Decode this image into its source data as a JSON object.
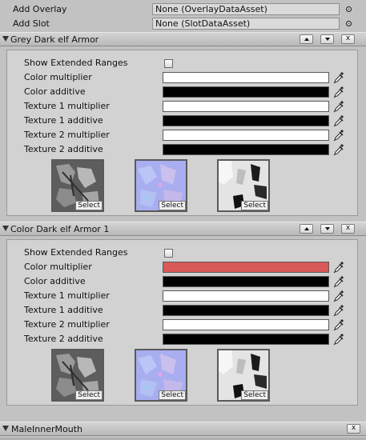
{
  "add_overlay": {
    "label": "Add Overlay",
    "value": "None (OverlayDataAsset)"
  },
  "add_slot": {
    "label": "Add Slot",
    "value": "None (SlotDataAsset)"
  },
  "sections": [
    {
      "title": "Grey Dark elf Armor",
      "show_extended_label": "Show Extended Ranges",
      "rows": [
        {
          "label": "Color multiplier",
          "color": "#ffffff"
        },
        {
          "label": "Color additive",
          "color": "#000000"
        },
        {
          "label": "Texture 1 multiplier",
          "color": "#ffffff"
        },
        {
          "label": "Texture 1 additive",
          "color": "#000000"
        },
        {
          "label": "Texture 2 multiplier",
          "color": "#ffffff"
        },
        {
          "label": "Texture 2 additive",
          "color": "#000000"
        }
      ],
      "textures": [
        {
          "select_label": "Select"
        },
        {
          "select_label": "Select"
        },
        {
          "select_label": "Select"
        }
      ]
    },
    {
      "title": "Color Dark elf Armor 1",
      "show_extended_label": "Show Extended Ranges",
      "rows": [
        {
          "label": "Color multiplier",
          "color": "#d95858"
        },
        {
          "label": "Color additive",
          "color": "#000000"
        },
        {
          "label": "Texture 1 multiplier",
          "color": "#ffffff"
        },
        {
          "label": "Texture 1 additive",
          "color": "#000000"
        },
        {
          "label": "Texture 2 multiplier",
          "color": "#ffffff"
        },
        {
          "label": "Texture 2 additive",
          "color": "#000000"
        }
      ],
      "textures": [
        {
          "select_label": "Select"
        },
        {
          "select_label": "Select"
        },
        {
          "select_label": "Select"
        }
      ]
    }
  ],
  "bottom_section": {
    "title": "MaleInnerMouth"
  },
  "icons": {
    "collapse": "triangle-down-icon",
    "move_up": "arrow-up-icon",
    "move_down": "arrow-down-icon",
    "remove": "close-icon",
    "picker": "eyedropper-icon",
    "object_picker": "object-picker-icon"
  }
}
